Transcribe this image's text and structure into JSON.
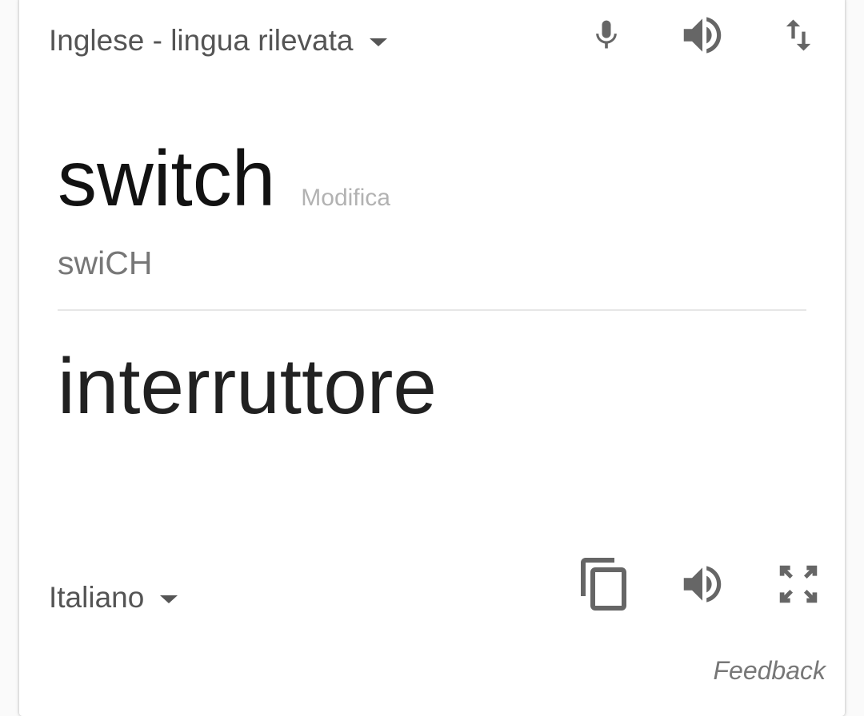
{
  "source_language": {
    "label": "Inglese - lingua rilevata"
  },
  "target_language": {
    "label": "Italiano"
  },
  "toolbar_top": {
    "icons": [
      "microphone-icon",
      "speaker-icon",
      "swap-languages-icon"
    ]
  },
  "toolbar_bottom": {
    "icons": [
      "copy-icon",
      "speaker-icon",
      "fullscreen-icon"
    ]
  },
  "source": {
    "word": "switch",
    "edit_label": "Modifica",
    "phonetic": "swiCH"
  },
  "translation": {
    "word": "interruttore"
  },
  "footer": {
    "feedback_label": "Feedback"
  },
  "colors": {
    "icon": "#666666",
    "source_text": "#121212",
    "translation_text": "#212121",
    "secondary_text": "#777777",
    "edit_link": "#b2b2b2",
    "divider": "#e6e6e6"
  }
}
